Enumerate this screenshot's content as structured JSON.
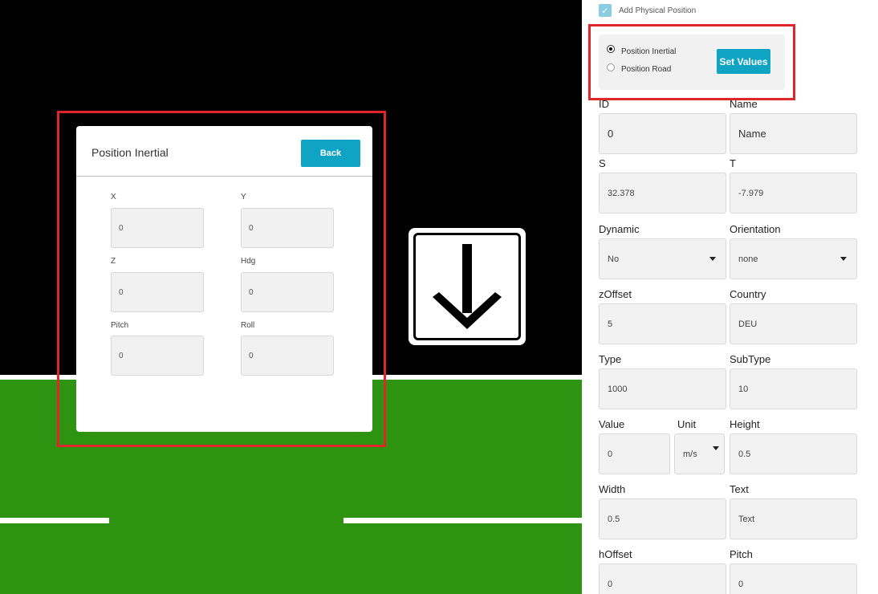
{
  "dialog": {
    "title": "Position Inertial",
    "back_label": "Back",
    "fields": [
      {
        "label": "X",
        "value": "0"
      },
      {
        "label": "Y",
        "value": "0"
      },
      {
        "label": "Z",
        "value": "0"
      },
      {
        "label": "Hdg",
        "value": "0"
      },
      {
        "label": "Pitch",
        "value": "0"
      },
      {
        "label": "Roll",
        "value": "0"
      }
    ]
  },
  "panel": {
    "checkbox_label": "Add Physical Position",
    "radio_inertial": "Position Inertial",
    "radio_road": "Position Road",
    "set_values_label": "Set Values",
    "fields": {
      "id": {
        "label": "ID",
        "value": "0"
      },
      "name": {
        "label": "Name",
        "value": "Name"
      },
      "s": {
        "label": "S",
        "value": "32.378"
      },
      "t": {
        "label": "T",
        "value": "-7.979"
      },
      "dynamic": {
        "label": "Dynamic",
        "value": "No"
      },
      "orientation": {
        "label": "Orientation",
        "value": "none"
      },
      "zoffset": {
        "label": "zOffset",
        "value": "5"
      },
      "country": {
        "label": "Country",
        "value": "DEU"
      },
      "type": {
        "label": "Type",
        "value": "1000"
      },
      "subtype": {
        "label": "SubType",
        "value": "10"
      },
      "value": {
        "label": "Value",
        "value": "0"
      },
      "unit": {
        "label": "Unit",
        "value": "m/s"
      },
      "height": {
        "label": "Height",
        "value": "0.5"
      },
      "width": {
        "label": "Width",
        "value": "0.5"
      },
      "text": {
        "label": "Text",
        "value": "Text"
      },
      "hoffset": {
        "label": "hOffset",
        "value": "0"
      },
      "pitch": {
        "label": "Pitch",
        "value": "0"
      }
    }
  },
  "colors": {
    "accent": "#0fa3c4",
    "highlight": "#e0262b",
    "grass": "#2f9312"
  }
}
